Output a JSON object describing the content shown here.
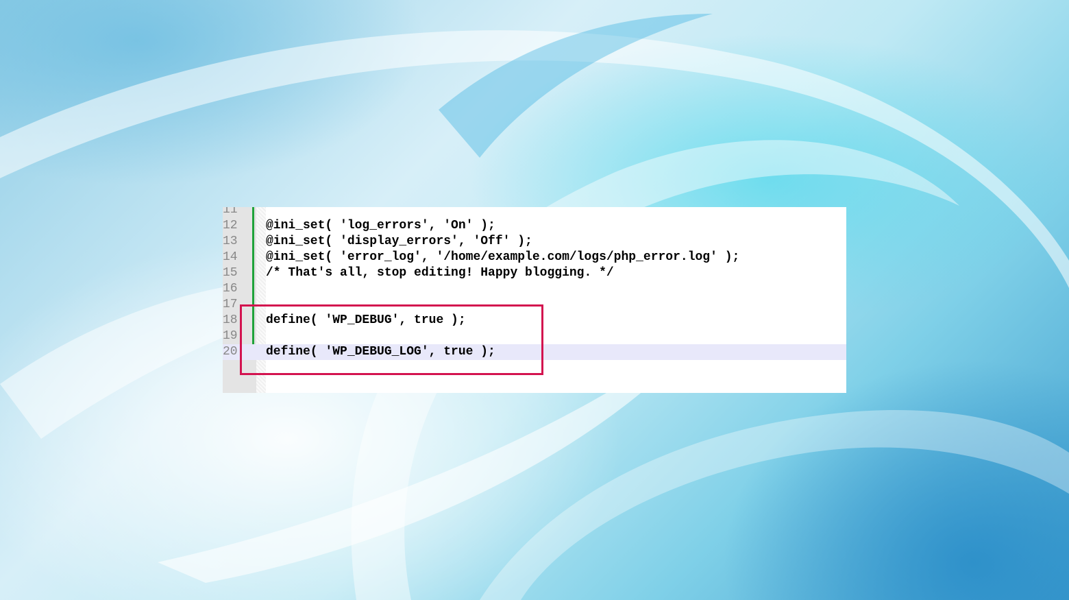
{
  "editor": {
    "lines": [
      {
        "num": "11",
        "code": ""
      },
      {
        "num": "12",
        "code": "@ini_set( 'log_errors', 'On' );"
      },
      {
        "num": "13",
        "code": "@ini_set( 'display_errors', 'Off' );"
      },
      {
        "num": "14",
        "code": "@ini_set( 'error_log', '/home/example.com/logs/php_error.log' );"
      },
      {
        "num": "15",
        "code": "/* That's all, stop editing! Happy blogging. */"
      },
      {
        "num": "16",
        "code": ""
      },
      {
        "num": "17",
        "code": ""
      },
      {
        "num": "18",
        "code": "define( 'WP_DEBUG', true );"
      },
      {
        "num": "19",
        "code": ""
      },
      {
        "num": "20",
        "code": "define( 'WP_DEBUG_LOG', true );"
      }
    ],
    "current_line": "20"
  },
  "colors": {
    "highlight_box": "#d3134f",
    "change_bar": "#1fa33a",
    "current_line_bg": "#e8e8fa",
    "line_number": "#888888"
  }
}
